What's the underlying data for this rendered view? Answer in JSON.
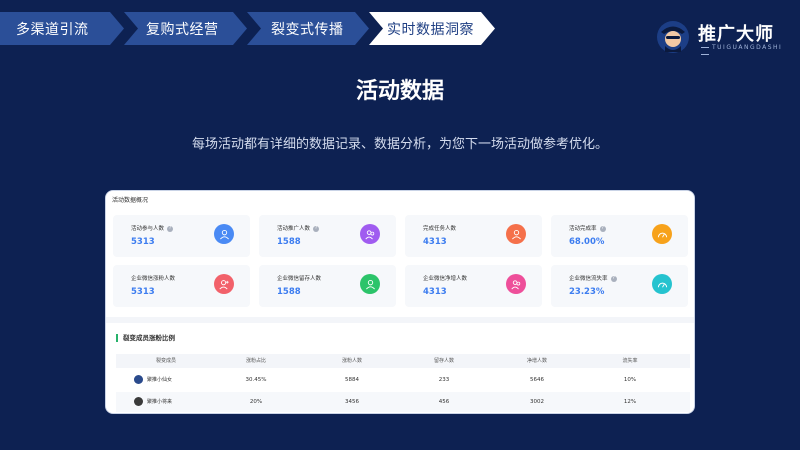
{
  "nav": {
    "steps": [
      {
        "label": "多渠道引流",
        "active": false
      },
      {
        "label": "复购式经营",
        "active": false
      },
      {
        "label": "裂变式传播",
        "active": false
      },
      {
        "label": "实时数据洞察",
        "active": true
      }
    ]
  },
  "brand": {
    "name": "推广大师",
    "sub": "TUIGUANGDASHI"
  },
  "title": "活动数据",
  "subtitle": "每场活动都有详细的数据记录、数据分析，为您下一场活动做参考优化。",
  "panel": {
    "header": "活动数据概况",
    "cards": [
      {
        "label": "活动参与人数",
        "value": "5313",
        "help": "?",
        "icon": "user-icon",
        "color": "#4a8af4"
      },
      {
        "label": "活动推广人数",
        "value": "1588",
        "help": "?",
        "icon": "users-icon",
        "color": "#a05cf0"
      },
      {
        "label": "完成任务人数",
        "value": "4313",
        "help": "",
        "icon": "user-check-icon",
        "color": "#f5704a"
      },
      {
        "label": "活动完成率",
        "value": "68.00%",
        "help": "?",
        "icon": "gauge-icon",
        "color": "#f7a21b"
      },
      {
        "label": "企业微信涨粉人数",
        "value": "5313",
        "help": "",
        "icon": "user-plus-icon",
        "color": "#f2616a"
      },
      {
        "label": "企业微信留存人数",
        "value": "1588",
        "help": "",
        "icon": "user-icon",
        "color": "#2cc46a"
      },
      {
        "label": "企业微信净增人数",
        "value": "4313",
        "help": "",
        "icon": "users-icon",
        "color": "#ee4f9a"
      },
      {
        "label": "企业微信流失率",
        "value": "23.23%",
        "help": "?",
        "icon": "gauge-icon",
        "color": "#25c3cf"
      }
    ],
    "section_title": "裂变成员涨粉比例",
    "columns": [
      "裂变成员",
      "涨粉占比",
      "涨粉人数",
      "留存人数",
      "净增人数",
      "流失率"
    ],
    "rows": [
      {
        "member": "聚推小仙女",
        "ratio": "30.45%",
        "gain": "5884",
        "retained": "233",
        "net": "5646",
        "loss": "10%",
        "avatar_color": "#2a4a8c"
      },
      {
        "member": "聚推小将来",
        "ratio": "20%",
        "gain": "3456",
        "retained": "456",
        "net": "3002",
        "loss": "12%",
        "avatar_color": "#3a3a3a"
      }
    ]
  }
}
